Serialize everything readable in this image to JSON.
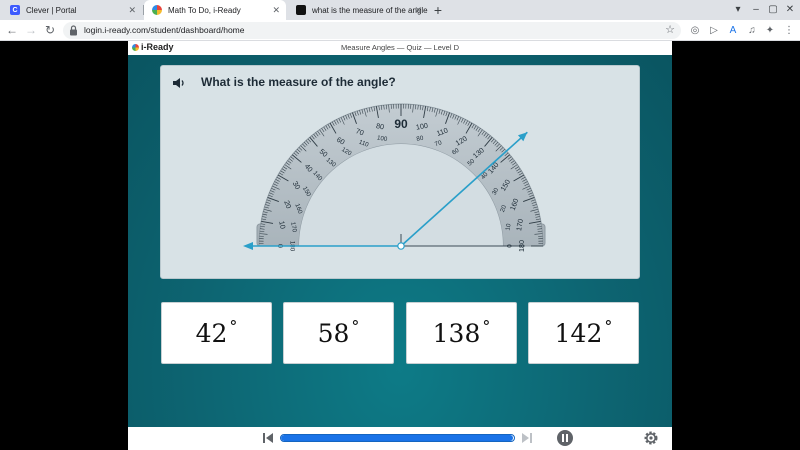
{
  "browser": {
    "tabs": [
      {
        "title": "Clever | Portal",
        "favicon_letter": "C",
        "favicon_color": "#3d5afe",
        "active": false
      },
      {
        "title": "Math To Do, i-Ready",
        "favicon_letter": "",
        "favicon_color": "#f6bb2e",
        "active": true
      },
      {
        "title": "what is the measure of the angle",
        "favicon_letter": "",
        "favicon_color": "#111111",
        "active": false
      }
    ],
    "new_tab_label": "+",
    "url": "login.i-ready.com/student/dashboard/home"
  },
  "app": {
    "logo_text": "i-Ready",
    "lesson_title": "Measure Angles — Quiz — Level D"
  },
  "question": {
    "text": "What is the measure of the angle?",
    "protractor": {
      "outer_labels": [
        "0",
        "10",
        "20",
        "30",
        "40",
        "50",
        "60",
        "70",
        "80",
        "90",
        "100",
        "110",
        "120",
        "130",
        "140",
        "150",
        "160",
        "170",
        "180"
      ],
      "inner_labels": [
        "180",
        "170",
        "160",
        "150",
        "140",
        "130",
        "120",
        "110",
        "100",
        "",
        "80",
        "70",
        "60",
        "50",
        "40",
        "30",
        "20",
        "10",
        "0"
      ],
      "ray_angle_deg": 138
    }
  },
  "answers": [
    {
      "value": "42",
      "unit": "°"
    },
    {
      "value": "58",
      "unit": "°"
    },
    {
      "value": "138",
      "unit": "°"
    },
    {
      "value": "142",
      "unit": "°"
    }
  ],
  "progress": {
    "fraction": 0.995
  },
  "colors": {
    "ray": "#2a9fc9",
    "progress": "#1a73e8",
    "teal": "#0d6a77"
  }
}
